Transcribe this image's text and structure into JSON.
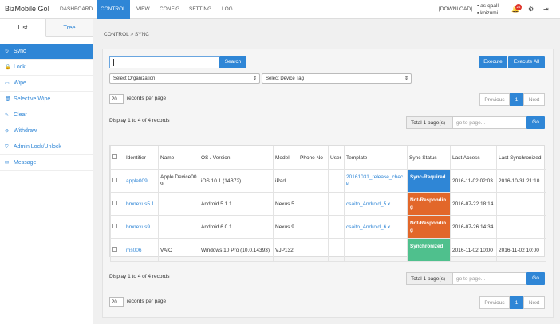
{
  "app": {
    "brand": "BizMobile Go!",
    "nav": [
      "DASHBOARD",
      "CONTROL",
      "VIEW",
      "CONFIG",
      "SETTING",
      "LOG"
    ],
    "download_label": "[DOWNLOAD]",
    "user_line1": "as-qaall",
    "user_line2": "koizumi",
    "notification_count": "24"
  },
  "sidebar": {
    "tabs": [
      "List",
      "Tree"
    ],
    "items": [
      {
        "icon": "↻",
        "label": "Sync"
      },
      {
        "icon": "🔒",
        "label": "Lock"
      },
      {
        "icon": "▭",
        "label": "Wipe"
      },
      {
        "icon": "🗑",
        "label": "Selective Wipe"
      },
      {
        "icon": "✎",
        "label": "Clear"
      },
      {
        "icon": "⊘",
        "label": "Withdraw"
      },
      {
        "icon": "⛉",
        "label": "Admin Lock/Unlock"
      },
      {
        "icon": "✉",
        "label": "Message"
      }
    ]
  },
  "breadcrumb": "CONTROL > SYNC",
  "toolbar": {
    "search_label": "Search",
    "search_value": "",
    "execute_label": "Execute",
    "execute_all_label": "Execute All",
    "org_select": "Select Organization",
    "tag_select": "Select Device Tag"
  },
  "paging": {
    "per_page": "20",
    "per_page_label": "records per page",
    "previous": "Previous",
    "current": "1",
    "next": "Next",
    "display": "Display 1 to 4 of 4 records",
    "total_pages": "Total 1 page(s)",
    "goto_placeholder": "go to page...",
    "go": "Go"
  },
  "table": {
    "headers": [
      "",
      "Identifier",
      "Name",
      "OS / Version",
      "Model",
      "Phone No",
      "User",
      "Template",
      "Sync Status",
      "Last Access",
      "Last Synchronized"
    ],
    "rows": [
      {
        "identifier": "apple009",
        "name": "Apple Device009",
        "os": "iOS 10.1 (14B72)",
        "model": "iPad",
        "phone": "",
        "user": "",
        "template": "20161031_release_check",
        "status": "Sync-Required",
        "status_color": "#2f86d6",
        "last_access": "2016-11-02 02:03",
        "last_sync": "2016-10-31 21:10"
      },
      {
        "identifier": "bmnexus5.1",
        "name": "",
        "os": "Android 5.1.1",
        "model": "Nexus 5",
        "phone": "",
        "user": "",
        "template": "csaito_Android_5.x",
        "status": "Not-Responding",
        "status_color": "#e2672a",
        "last_access": "2016-07-22 18:14",
        "last_sync": ""
      },
      {
        "identifier": "bmnexus9",
        "name": "",
        "os": "Android 6.0.1",
        "model": "Nexus 9",
        "phone": "",
        "user": "",
        "template": "csaito_Android_6.x",
        "status": "Not-Responding",
        "status_color": "#e2672a",
        "last_access": "2016-07-26 14:34",
        "last_sync": ""
      },
      {
        "identifier": "ms006",
        "name": "VAIO",
        "os": "Windows 10 Pro (10.0.14393)",
        "model": "VJP132",
        "phone": "",
        "user": "",
        "template": "",
        "status": "Synchronized",
        "status_color": "#4fc08d",
        "last_access": "2016-11-02 10:00",
        "last_sync": "2016-11-02 10:00"
      }
    ]
  }
}
